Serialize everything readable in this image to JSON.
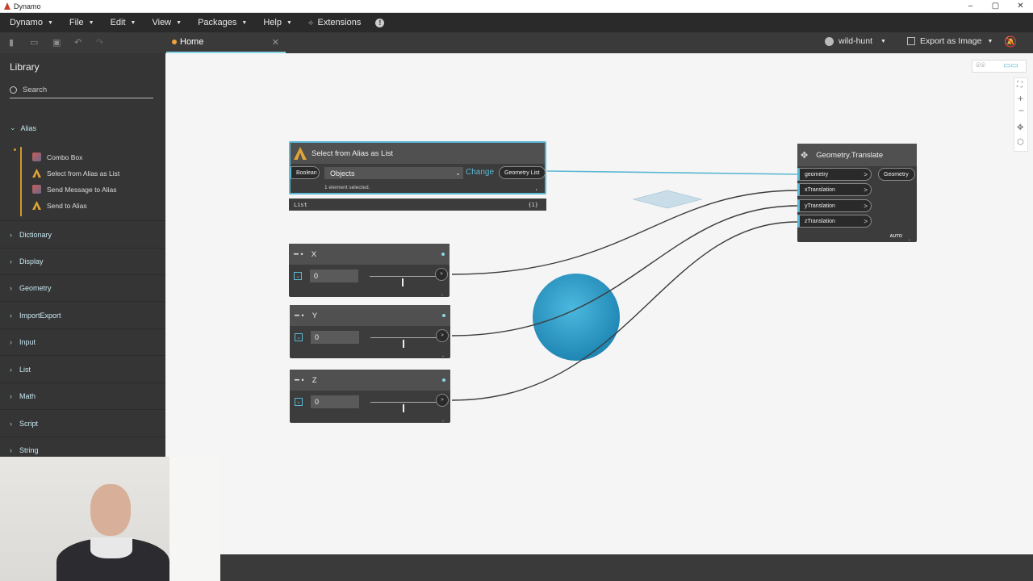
{
  "window": {
    "title": "Dynamo",
    "controls": [
      "–",
      "▢",
      "✕"
    ]
  },
  "menu": {
    "items": [
      "Dynamo",
      "File",
      "Edit",
      "View",
      "Packages",
      "Help"
    ],
    "extensions": "Extensions"
  },
  "tab": {
    "label": "Home"
  },
  "user": {
    "name": "wild-hunt"
  },
  "export": {
    "label": "Export as Image"
  },
  "library": {
    "title": "Library",
    "search_placeholder": "Search",
    "alias_category": "Alias",
    "alias_items": [
      {
        "label": "Combo Box",
        "icon": "combo-box-icon"
      },
      {
        "label": "Select from Alias as List",
        "icon": "alias-icon"
      },
      {
        "label": "Send Message to Alias",
        "icon": "combo-box-icon"
      },
      {
        "label": "Send to Alias",
        "icon": "alias-icon"
      }
    ],
    "categories": [
      "Dictionary",
      "Display",
      "Geometry",
      "ImportExport",
      "Input",
      "List",
      "Math",
      "Script",
      "String"
    ]
  },
  "nodes": {
    "select_alias": {
      "title": "Select from Alias as List",
      "input_port": "Boolean",
      "dropdown_value": "Objects",
      "change_label": "Change",
      "output_port": "Geometry List",
      "status": "1 element selected.",
      "preview_label": "List",
      "preview_count": "{1}"
    },
    "sliders": [
      {
        "name": "X",
        "value": "0",
        "position": 0.5
      },
      {
        "name": "Y",
        "value": "0",
        "position": 0.5
      },
      {
        "name": "Z",
        "value": "0",
        "position": 0.5
      }
    ],
    "translate": {
      "title": "Geometry.Translate",
      "inputs": [
        "geometry",
        "xTranslation",
        "yTranslation",
        "zTranslation"
      ],
      "output": "Geometry",
      "lacing": "AUTO"
    }
  },
  "colors": {
    "accent": "#5bb7d4",
    "sphere": "#2d9bc4",
    "canvas": "#f5f5f5"
  }
}
